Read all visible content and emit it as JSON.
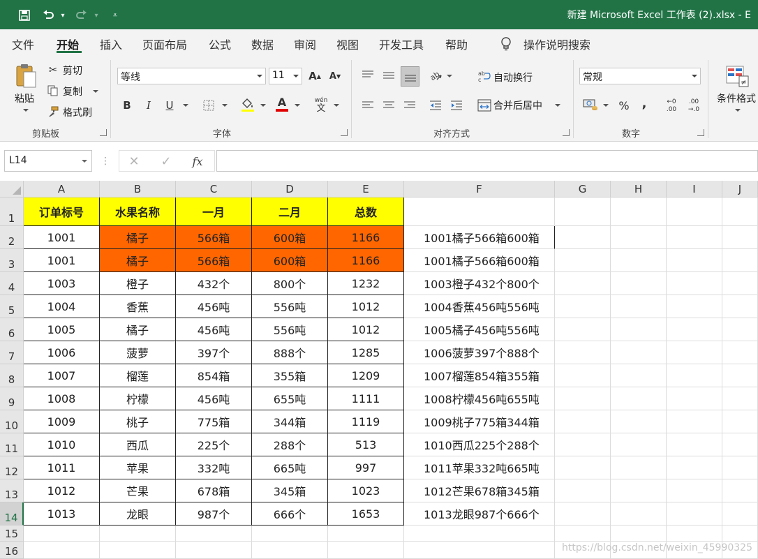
{
  "window": {
    "title": "新建 Microsoft Excel 工作表 (2).xlsx  -  E"
  },
  "ribbon_tabs": [
    "文件",
    "开始",
    "插入",
    "页面布局",
    "公式",
    "数据",
    "审阅",
    "视图",
    "开发工具",
    "帮助"
  ],
  "active_tab": "开始",
  "tell_me": "操作说明搜索",
  "clipboard": {
    "paste": "粘贴",
    "cut": "剪切",
    "copy": "复制",
    "format_painter": "格式刷",
    "label": "剪贴板"
  },
  "font": {
    "name": "等线",
    "size": "11",
    "label": "字体",
    "bold": "B",
    "italic": "I",
    "underline": "U",
    "phonetic": "wén"
  },
  "alignment": {
    "wrap_text": "自动换行",
    "merge_center": "合并后居中",
    "label": "对齐方式"
  },
  "number": {
    "format": "常规",
    "percent": "%",
    "comma": ",",
    "inc_decimal_top": "←0",
    "inc_decimal_bottom": ".00",
    "dec_decimal_top": ".00",
    "dec_decimal_bottom": "→.0",
    "label": "数字"
  },
  "styles": {
    "conditional_format": "条件格式"
  },
  "formula_bar": {
    "name_box": "L14",
    "fx": "fx",
    "formula": ""
  },
  "columns": [
    "A",
    "B",
    "C",
    "D",
    "E",
    "F",
    "G",
    "H",
    "I",
    "J"
  ],
  "row_numbers": [
    "1",
    "2",
    "3",
    "4",
    "5",
    "6",
    "7",
    "8",
    "9",
    "10",
    "11",
    "12",
    "13",
    "14",
    "15",
    "16"
  ],
  "selected_row": "14",
  "table": {
    "headers": [
      "订单标号",
      "水果名称",
      "一月",
      "二月",
      "总数"
    ],
    "rows": [
      [
        "1001",
        "橘子",
        "566箱",
        "600箱",
        "1166",
        "1001橘子566箱600箱"
      ],
      [
        "1001",
        "橘子",
        "566箱",
        "600箱",
        "1166",
        "1001橘子566箱600箱"
      ],
      [
        "1003",
        "橙子",
        "432个",
        "800个",
        "1232",
        "1003橙子432个800个"
      ],
      [
        "1004",
        "香蕉",
        "456吨",
        "556吨",
        "1012",
        "1004香蕉456吨556吨"
      ],
      [
        "1005",
        "橘子",
        "456吨",
        "556吨",
        "1012",
        "1005橘子456吨556吨"
      ],
      [
        "1006",
        "菠萝",
        "397个",
        "888个",
        "1285",
        "1006菠萝397个888个"
      ],
      [
        "1007",
        "榴莲",
        "854箱",
        "355箱",
        "1209",
        "1007榴莲854箱355箱"
      ],
      [
        "1008",
        "柠檬",
        "456吨",
        "655吨",
        "1111",
        "1008柠檬456吨655吨"
      ],
      [
        "1009",
        "桃子",
        "775箱",
        "344箱",
        "1119",
        "1009桃子775箱344箱"
      ],
      [
        "1010",
        "西瓜",
        "225个",
        "288个",
        "513",
        "1010西瓜225个288个"
      ],
      [
        "1011",
        "苹果",
        "332吨",
        "665吨",
        "997",
        "1011苹果332吨665吨"
      ],
      [
        "1012",
        "芒果",
        "678箱",
        "345箱",
        "1023",
        "1012芒果678箱345箱"
      ],
      [
        "1013",
        "龙眼",
        "987个",
        "666个",
        "1653",
        "1013龙眼987个666个"
      ]
    ]
  },
  "colors": {
    "title_bar": "#217346",
    "header_fill": "#ffff00",
    "duplicate_fill": "#ff6600"
  },
  "watermark": "https://blog.csdn.net/weixin_45990325"
}
